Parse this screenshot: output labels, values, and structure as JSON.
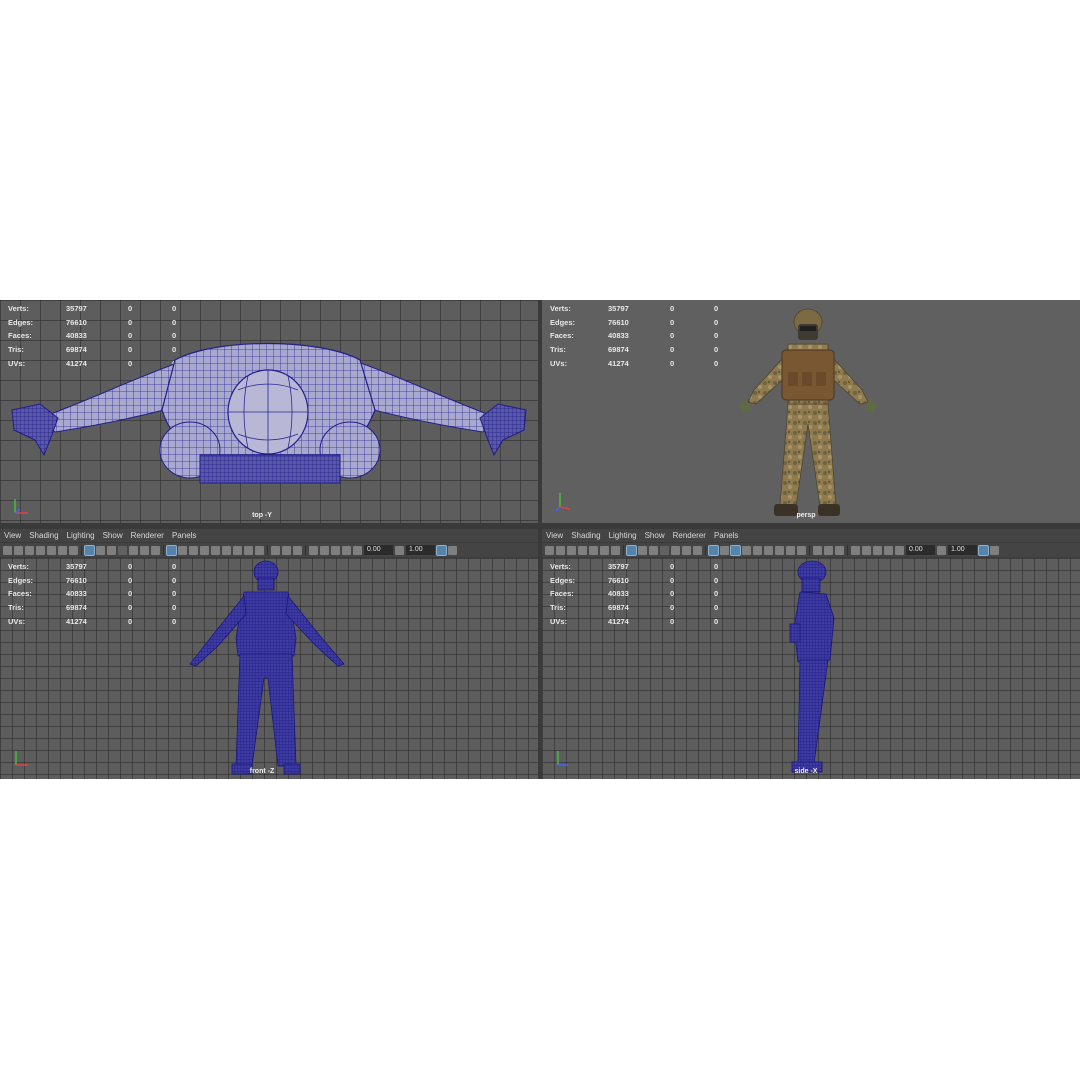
{
  "hud": {
    "labels": [
      "Verts:",
      "Edges:",
      "Faces:",
      "Tris:",
      "UVs:"
    ],
    "values": [
      "35797",
      "76610",
      "40833",
      "69874",
      "41274"
    ],
    "zero": "0"
  },
  "cameras": {
    "top": "top -Y",
    "persp": "persp",
    "front": "front -Z",
    "side": "side -X"
  },
  "menu": [
    "View",
    "Shading",
    "Lighting",
    "Show",
    "Renderer",
    "Panels"
  ],
  "toolbar": {
    "field_a": "0.00",
    "field_b": "1.00"
  },
  "colors": {
    "wireframe": "#24228f",
    "wire_fill": "#9b9bc4",
    "viewport_bg": "#5d5d5d",
    "camo": "#8d7a4e"
  },
  "icons": [
    "camera-icon",
    "grid-icon",
    "wireframe-icon",
    "smooth-shade-icon",
    "texture-icon",
    "light-icon",
    "isolate-icon",
    "xray-icon"
  ]
}
